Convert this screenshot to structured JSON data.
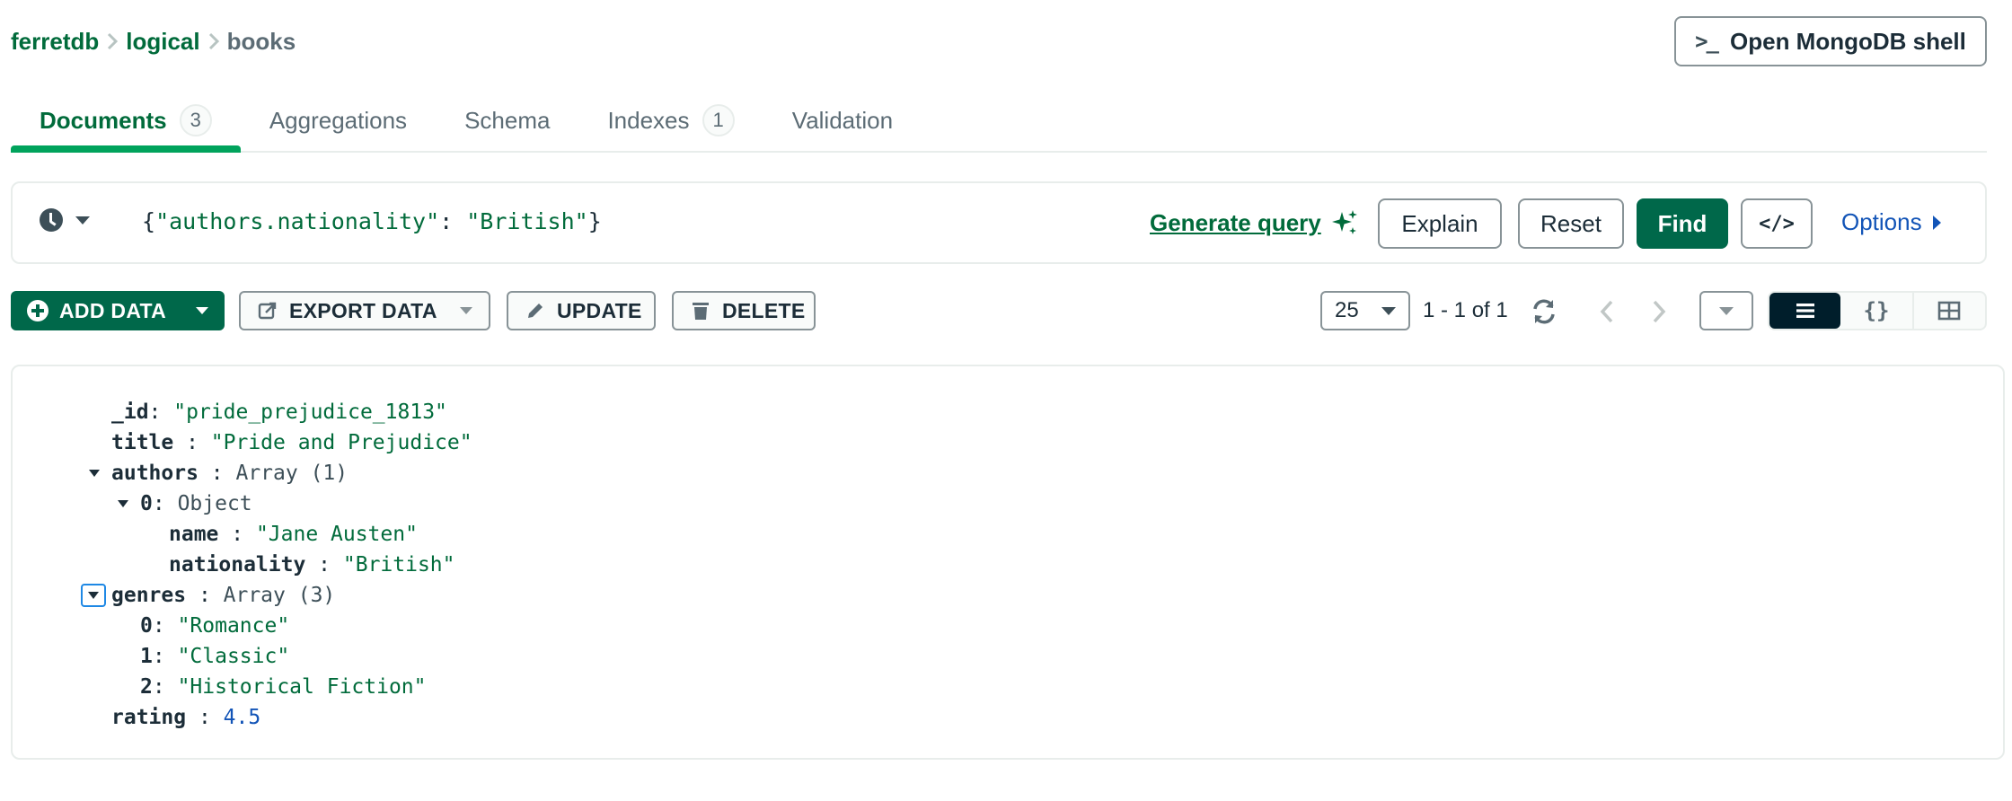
{
  "breadcrumb": {
    "items": [
      "ferretdb",
      "logical",
      "books"
    ]
  },
  "header": {
    "shell_button_prompt": ">_",
    "shell_button_label": "Open MongoDB shell"
  },
  "tabs": [
    {
      "label": "Documents",
      "count": "3",
      "active": true
    },
    {
      "label": "Aggregations"
    },
    {
      "label": "Schema"
    },
    {
      "label": "Indexes",
      "count": "1"
    },
    {
      "label": "Validation"
    }
  ],
  "query_bar": {
    "filter_open": "{",
    "filter_key": "\"authors.nationality\"",
    "filter_colon": ": ",
    "filter_value": "\"British\"",
    "filter_close": "}",
    "generate_query": "Generate query",
    "explain": "Explain",
    "reset": "Reset",
    "find": "Find",
    "code": "</>",
    "options": "Options"
  },
  "toolbar": {
    "add_data": "ADD DATA",
    "export_data": "EXPORT DATA",
    "update": "UPDATE",
    "delete": "DELETE",
    "page_size": "25",
    "range": "1 - 1 of 1",
    "json_view_glyph": "{}"
  },
  "document": {
    "id_key": "_id",
    "id_value": "\"pride_prejudice_1813\"",
    "title_key": "title",
    "title_value": "\"Pride and Prejudice\"",
    "authors_key": "authors",
    "authors_type": "Array (1)",
    "author0_key": "0",
    "author0_type": "Object",
    "name_key": "name",
    "name_value": "\"Jane Austen\"",
    "nationality_key": "nationality",
    "nationality_value": "\"British\"",
    "genres_key": "genres",
    "genres_type": "Array (3)",
    "genre0_key": "0",
    "genre0_value": "\"Romance\"",
    "genre1_key": "1",
    "genre1_value": "\"Classic\"",
    "genre2_key": "2",
    "genre2_value": "\"Historical Fiction\"",
    "rating_key": "rating",
    "rating_value": "4.5"
  },
  "colors": {
    "brand_green": "#00684a",
    "link_green": "#016b3b",
    "tab_indicator": "#00a35c",
    "link_blue": "#1254b7",
    "dark_toggle": "#001e2b"
  }
}
